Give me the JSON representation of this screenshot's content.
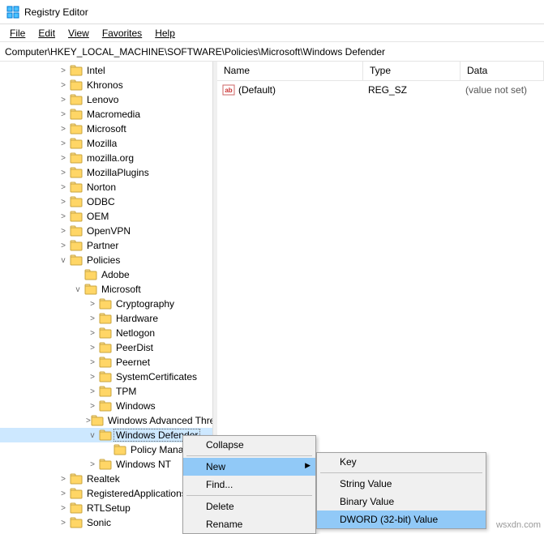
{
  "app": {
    "title": "Registry Editor"
  },
  "menu": {
    "file": "File",
    "edit": "Edit",
    "view": "View",
    "favorites": "Favorites",
    "help": "Help"
  },
  "address": "Computer\\HKEY_LOCAL_MACHINE\\SOFTWARE\\Policies\\Microsoft\\Windows Defender",
  "columns": {
    "name": "Name",
    "type": "Type",
    "data": "Data"
  },
  "values": [
    {
      "name": "(Default)",
      "type": "REG_SZ",
      "data": "(value not set)"
    }
  ],
  "tree_top": {
    "items": [
      "Intel",
      "Khronos",
      "Lenovo",
      "Macromedia",
      "Microsoft",
      "Mozilla",
      "mozilla.org",
      "MozillaPlugins",
      "Norton",
      "ODBC",
      "OEM",
      "OpenVPN",
      "Partner"
    ],
    "policies": "Policies",
    "adobe": "Adobe",
    "microsoft2": "Microsoft"
  },
  "microsoft_children": [
    "Cryptography",
    "Hardware",
    "Netlogon",
    "PeerDist",
    "Peernet",
    "SystemCertificates",
    "TPM",
    "Windows",
    "Windows Advanced Threat Protection"
  ],
  "windows_defender": "Windows Defender",
  "policy_manager": "Policy Manager",
  "windows_nt": "Windows NT",
  "tree_bottom": [
    "Realtek",
    "RegisteredApplications",
    "RTLSetup",
    "Sonic"
  ],
  "context1": {
    "collapse": "Collapse",
    "new": "New",
    "find": "Find...",
    "delete": "Delete",
    "rename": "Rename"
  },
  "context2": {
    "key": "Key",
    "string": "String Value",
    "binary": "Binary Value",
    "dword": "DWORD (32-bit) Value"
  },
  "watermark": "wsxdn.com"
}
